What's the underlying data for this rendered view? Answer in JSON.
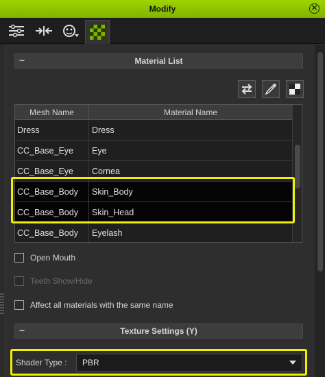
{
  "window": {
    "title": "Modify",
    "close_icon": "close-circle-icon"
  },
  "tabs": [
    {
      "icon": "sliders-icon",
      "active": false
    },
    {
      "icon": "morph-arrows-icon",
      "active": false
    },
    {
      "icon": "face-motion-icon",
      "active": false
    },
    {
      "icon": "checker-texture-icon",
      "active": true
    }
  ],
  "material_list": {
    "header": "Material List",
    "collapse_symbol": "−",
    "toolbar_icons": [
      "swap-icon",
      "eyedropper-icon",
      "checker-icon"
    ],
    "columns": [
      "Mesh Name",
      "Material Name"
    ],
    "rows": [
      {
        "mesh": "Dress",
        "material": "Dress"
      },
      {
        "mesh": "CC_Base_Eye",
        "material": "Eye"
      },
      {
        "mesh": "CC_Base_Eye",
        "material": "Cornea"
      },
      {
        "mesh": "CC_Base_Body",
        "material": "Skin_Body"
      },
      {
        "mesh": "CC_Base_Body",
        "material": "Skin_Head"
      },
      {
        "mesh": "CC_Base_Body",
        "material": "Eyelash"
      }
    ],
    "highlight_color": "#f0f000"
  },
  "options": {
    "open_mouth": "Open Mouth",
    "teeth_show_hide": "Teeth Show/Hide",
    "affect_all": "Affect all materials with the same name"
  },
  "texture_settings": {
    "header": "Texture Settings  (Y)",
    "collapse_symbol": "−",
    "shader_label": "Shader Type :",
    "shader_value": "PBR"
  },
  "colors": {
    "accent": "#8fc400",
    "highlight": "#f0f000"
  }
}
